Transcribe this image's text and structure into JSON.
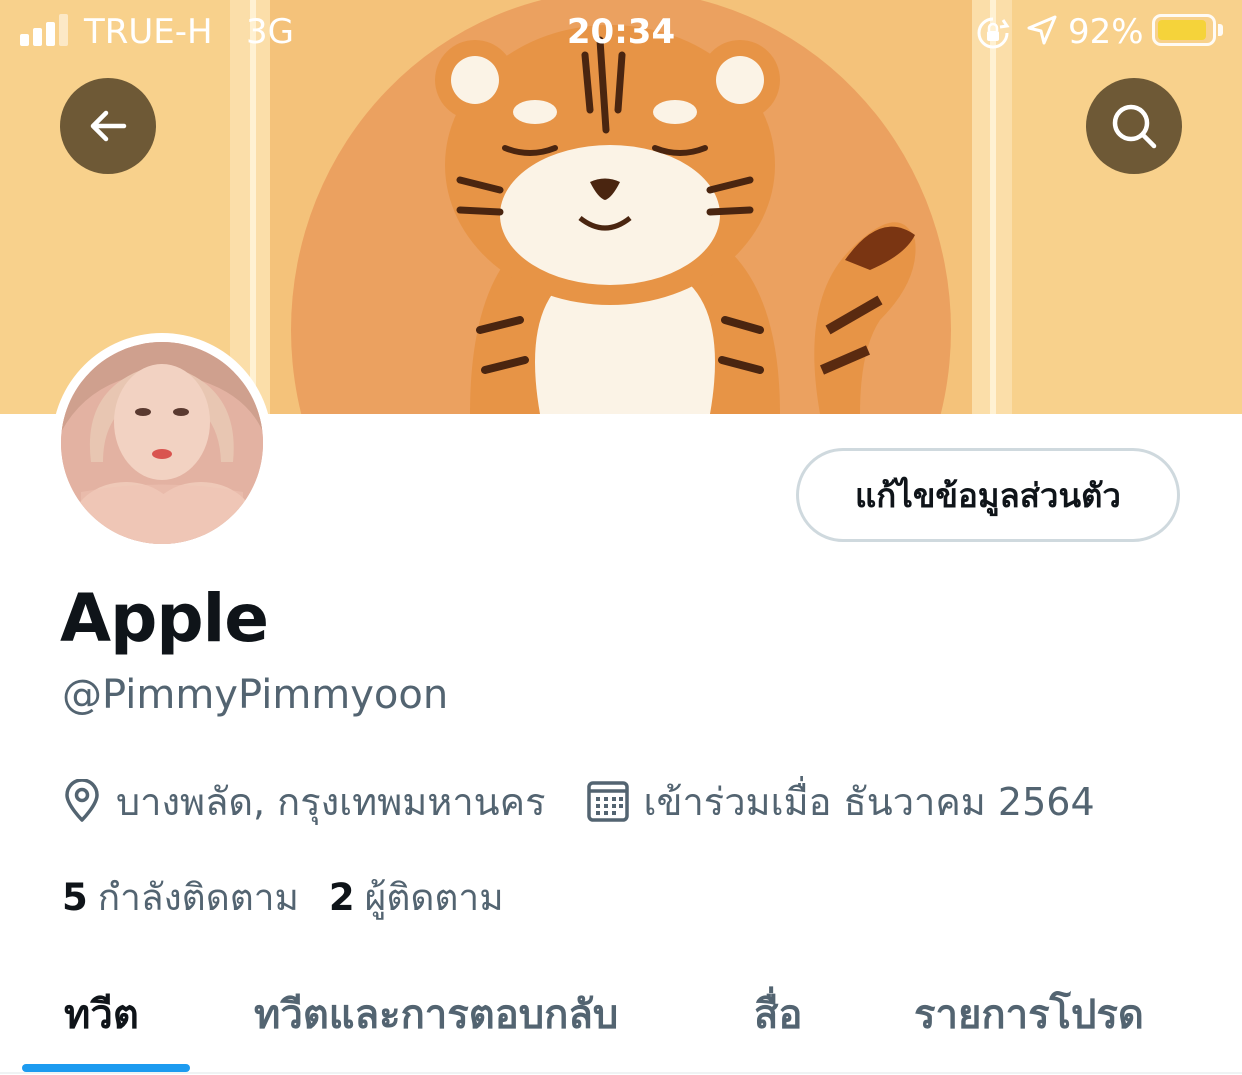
{
  "status_bar": {
    "carrier": "TRUE-H",
    "network": "3G",
    "time": "20:34",
    "battery_percent": "92%",
    "battery_level": 0.92,
    "battery_color": "#f5d33a",
    "icons": [
      "signal-bars-icon",
      "orientation-lock-icon",
      "location-arrow-icon",
      "battery-icon"
    ]
  },
  "header": {
    "back_icon": "arrow-left-icon",
    "search_icon": "search-icon"
  },
  "profile": {
    "edit_button_label": "แก้ไขข้อมูลส่วนตัว",
    "display_name": "Apple",
    "handle": "@PimmyPimmyoon",
    "location": "บางพลัด, กรุงเทพมหานคร",
    "joined": "เข้าร่วมเมื่อ ธันวาคม 2564",
    "following_count": "5",
    "following_label": "กำลังติดตาม",
    "followers_count": "2",
    "followers_label": "ผู้ติดตาม"
  },
  "tabs": [
    {
      "label": "ทวีต",
      "active": true
    },
    {
      "label": "ทวีตและการตอบกลับ",
      "active": false
    },
    {
      "label": "สื่อ",
      "active": false
    },
    {
      "label": "รายการโปรด",
      "active": false
    }
  ],
  "colors": {
    "accent": "#1d9bf0",
    "text_primary": "#0f1419",
    "text_secondary": "#536471"
  }
}
